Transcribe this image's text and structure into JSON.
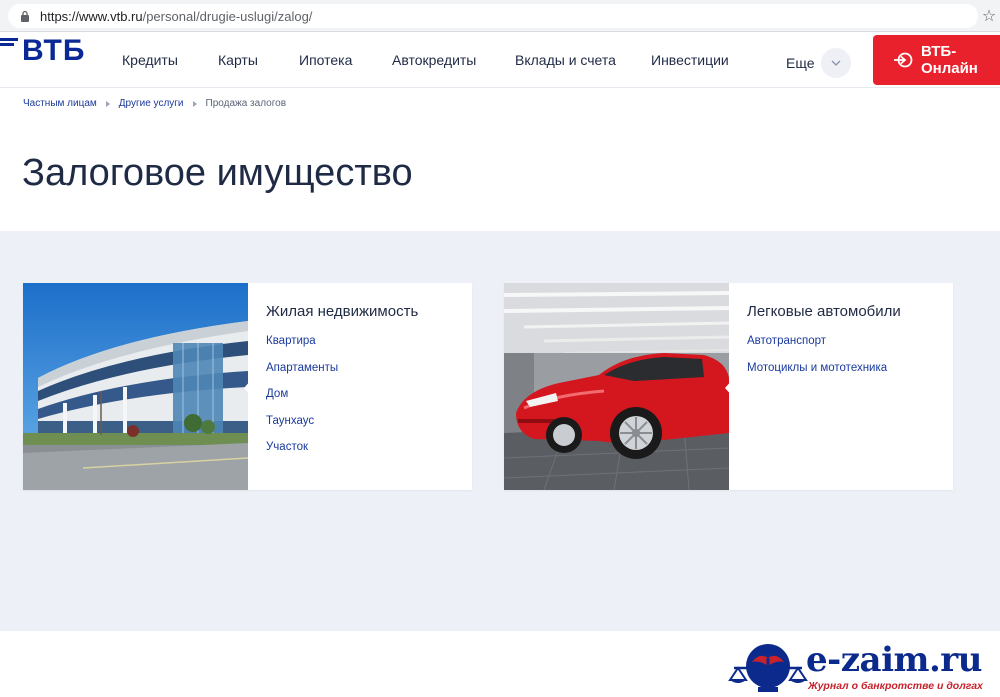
{
  "browser": {
    "url_host": "https://www.vtb.ru",
    "url_path": "/personal/drugie-uslugi/zalog/"
  },
  "header": {
    "logo": "ВТБ",
    "nav": [
      "Кредиты",
      "Карты",
      "Ипотека",
      "Автокредиты",
      "Вклады и счета",
      "Инвестиции"
    ],
    "more_label": "Еще",
    "online_label": "ВТБ-Онлайн"
  },
  "breadcrumb": {
    "items": [
      "Частным лицам",
      "Другие услуги"
    ],
    "current": "Продажа залогов"
  },
  "page": {
    "title": "Залоговое имущество"
  },
  "cards": [
    {
      "title": "Жилая недвижимость",
      "links": [
        "Квартира",
        "Апартаменты",
        "Дом",
        "Таунхаус",
        "Участок"
      ]
    },
    {
      "title": "Легковые автомобили",
      "links": [
        "Автотранспорт",
        "Мотоциклы и мототехника"
      ]
    }
  ],
  "watermark": {
    "name": "e-zaim.ru",
    "tagline": "Журнал о банкротстве и долгах"
  },
  "colors": {
    "brand_blue": "#0a2896",
    "link_blue": "#1a3a9c",
    "cta_red": "#e8212c",
    "catalog_bg": "#eef0f8"
  }
}
